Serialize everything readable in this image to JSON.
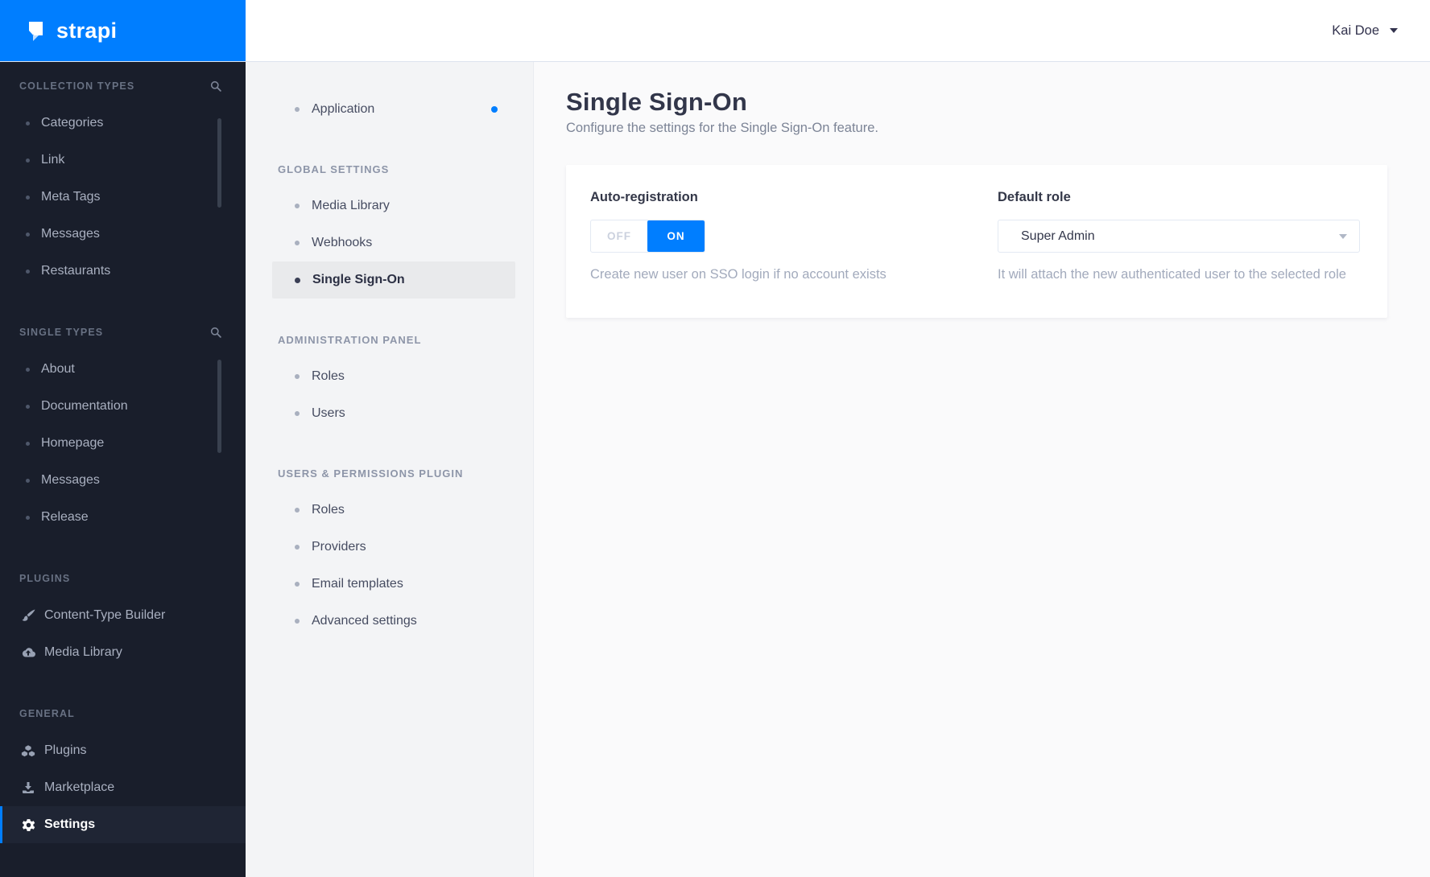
{
  "brand": {
    "logo_text": "strapi",
    "logo_icon": "strapi-logo-icon",
    "brand_color": "#007eff"
  },
  "header": {
    "user_name": "Kai Doe",
    "user_menu_icon": "chevron-down-icon"
  },
  "main_sidebar": {
    "background_color": "#191e2b",
    "sections": [
      {
        "label": "COLLECTION TYPES",
        "searchable": true,
        "search_icon": "search-icon",
        "items": [
          {
            "label": "Categories"
          },
          {
            "label": "Link"
          },
          {
            "label": "Meta Tags"
          },
          {
            "label": "Messages"
          },
          {
            "label": "Restaurants"
          }
        ]
      },
      {
        "label": "SINGLE TYPES",
        "searchable": true,
        "search_icon": "search-icon",
        "items": [
          {
            "label": "About"
          },
          {
            "label": "Documentation"
          },
          {
            "label": "Homepage"
          },
          {
            "label": "Messages"
          },
          {
            "label": "Release"
          }
        ]
      },
      {
        "label": "PLUGINS",
        "searchable": false,
        "items": [
          {
            "label": "Content-Type Builder",
            "icon": "paintbrush-icon"
          },
          {
            "label": "Media Library",
            "icon": "cloud-upload-icon"
          }
        ]
      },
      {
        "label": "GENERAL",
        "searchable": false,
        "items": [
          {
            "label": "Plugins",
            "icon": "cubes-icon"
          },
          {
            "label": "Marketplace",
            "icon": "download-icon"
          },
          {
            "label": "Settings",
            "icon": "gear-icon",
            "active": true
          }
        ]
      }
    ]
  },
  "settings_sidebar": {
    "application": {
      "label": "Application",
      "notification_dot": true,
      "notification_color": "#007eff"
    },
    "sections": [
      {
        "label": "GLOBAL SETTINGS",
        "items": [
          {
            "label": "Media Library"
          },
          {
            "label": "Webhooks"
          },
          {
            "label": "Single Sign-On",
            "active": true
          }
        ]
      },
      {
        "label": "ADMINISTRATION PANEL",
        "items": [
          {
            "label": "Roles"
          },
          {
            "label": "Users"
          }
        ]
      },
      {
        "label": "USERS & PERMISSIONS PLUGIN",
        "items": [
          {
            "label": "Roles"
          },
          {
            "label": "Providers"
          },
          {
            "label": "Email templates"
          },
          {
            "label": "Advanced settings"
          }
        ]
      }
    ]
  },
  "content": {
    "title": "Single Sign-On",
    "subtitle": "Configure the settings for the Single Sign-On feature.",
    "card": {
      "auto_registration": {
        "label": "Auto-registration",
        "off_label": "OFF",
        "on_label": "ON",
        "value": "ON",
        "on_color": "#007eff",
        "helper": "Create new user on SSO login if no account exists"
      },
      "default_role": {
        "label": "Default role",
        "value": "Super Admin",
        "dropdown_icon": "chevron-down-icon",
        "helper": "It will attach the new authenticated user to the selected role"
      }
    }
  },
  "colors": {
    "accent_blue": "#007eff",
    "sidebar_dark": "#191e2b",
    "content_background": "#fafafb"
  }
}
